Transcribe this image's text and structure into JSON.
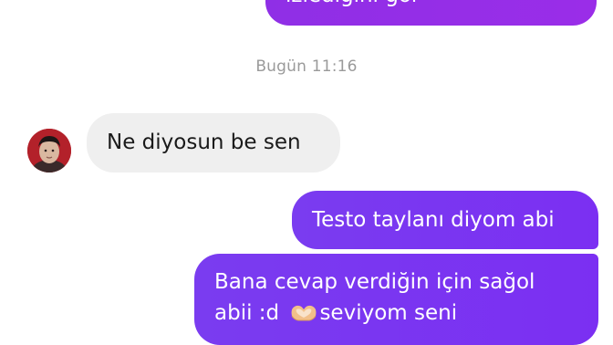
{
  "messages": {
    "prev_outgoing_text": "izlediğini gör",
    "timestamp": "Bugün 11:16",
    "incoming": {
      "text": "Ne diyosun be sen"
    },
    "outgoing_1": {
      "text": "Testo taylanı diyom abi"
    },
    "outgoing_2": {
      "line1": "Bana cevap verdiğin için sağol",
      "line2_prefix": "abii :d",
      "emoji": "heart-hands-icon",
      "line2_suffix": "seviyom seni"
    }
  },
  "colors": {
    "outgoing_bubble": "#7a35f0",
    "incoming_bubble": "#efefef",
    "timestamp_text": "#9a9a9a"
  }
}
